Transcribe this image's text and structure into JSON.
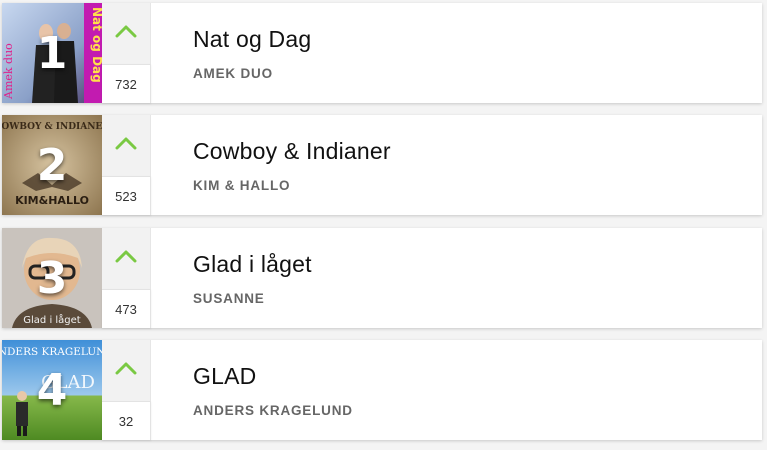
{
  "chart": {
    "entries": [
      {
        "rank": "1",
        "title": "Nat og Dag",
        "artist": "AMEK DUO",
        "votes": "732",
        "cover_text": "Nat og Dag",
        "cover_brand": "Amek duo",
        "up_icon": "chevron-up-icon"
      },
      {
        "rank": "2",
        "title": "Cowboy & Indianer",
        "artist": "KIM & HALLO",
        "votes": "523",
        "cover_text": "COWBOY & INDIANER",
        "cover_brand": "KIM&HALLO",
        "up_icon": "chevron-up-icon"
      },
      {
        "rank": "3",
        "title": "Glad i låget",
        "artist": "SUSANNE",
        "votes": "473",
        "cover_text": "Glad i låget",
        "up_icon": "chevron-up-icon"
      },
      {
        "rank": "4",
        "title": "GLAD",
        "artist": "ANDERS KRAGELUND",
        "votes": "32",
        "cover_text": "ANDERS KRAGELUND",
        "cover_brand": "GLAD",
        "up_icon": "chevron-up-icon"
      }
    ]
  },
  "colors": {
    "accent_green": "#7ac943"
  }
}
